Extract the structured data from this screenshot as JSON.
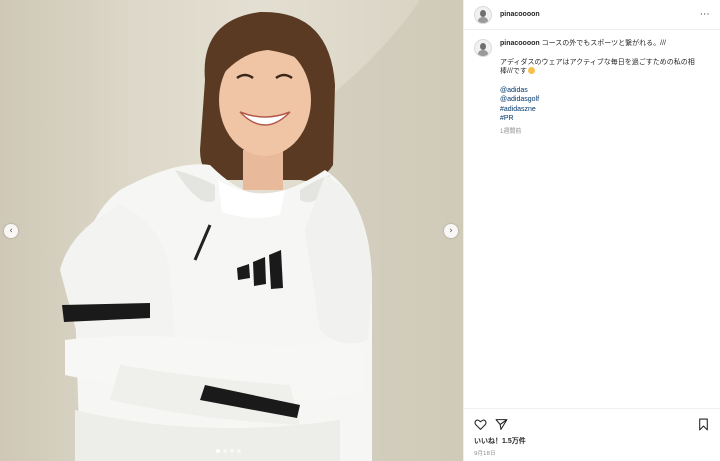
{
  "post": {
    "username": "pinacoooon",
    "more_label": "···",
    "caption": {
      "line1": "コースの外でもスポーツと繋がれる。///",
      "line2": "アディダスのウェアはアクティブな毎日を過ごすための私の相",
      "line3": "棒///です",
      "hashtags": [
        "@adidas",
        "@adidasgolf",
        "#adidaszne",
        "#PR"
      ],
      "time": "1週間前"
    },
    "likes": "いいね！1.5万件",
    "date": "9月18日"
  },
  "carousel": {
    "prev_icon": "‹",
    "next_icon": "›",
    "slides": 4,
    "active_slide": 1
  },
  "icons": {
    "like": "heart-icon",
    "share": "send-icon",
    "save": "bookmark-icon",
    "prev": "chevron-left-icon",
    "next": "chevron-right-icon"
  },
  "colors": {
    "link": "#00376b",
    "muted": "#8e8e8e",
    "text": "#262626",
    "divider": "#efefef"
  }
}
